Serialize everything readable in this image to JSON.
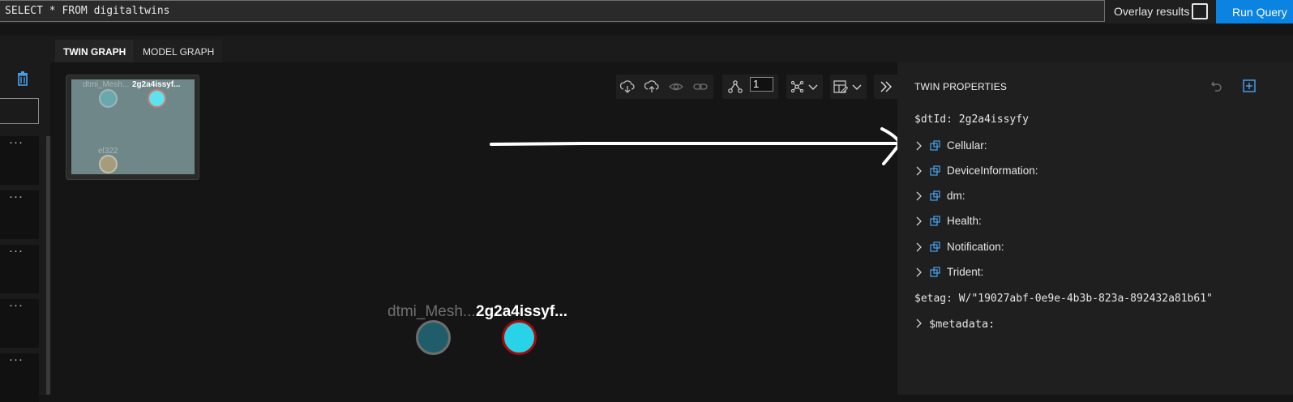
{
  "query": {
    "text": "SELECT * FROM digitaltwins"
  },
  "overlay": {
    "label": "Overlay results",
    "checked": false
  },
  "run_button": {
    "label": "Run Query"
  },
  "tabs": [
    {
      "label": "TWIN GRAPH",
      "active": true
    },
    {
      "label": "MODEL GRAPH",
      "active": false
    }
  ],
  "toolbar": {
    "expand_hops": "1"
  },
  "minimap": {
    "labels": [
      "dtmi_Mesh...",
      "2g2a4issyf...",
      "el322"
    ]
  },
  "graph": {
    "nodes": [
      {
        "label": "dtmi_Mesh...",
        "color": "#1f5d6b"
      },
      {
        "label": "2g2a4issyf...",
        "color": "#28d3e7",
        "selected": true
      }
    ]
  },
  "properties": {
    "title": "TWIN PROPERTIES",
    "dtId_key": "$dtId:",
    "dtId_value": "2g2a4issyfy",
    "components": [
      "Cellular:",
      "DeviceInformation:",
      "dm:",
      "Health:",
      "Notification:",
      "Trident:"
    ],
    "etag_key": "$etag:",
    "etag_value": "W/\"19027abf-0e9e-4b3b-823a-892432a81b61\"",
    "metadata_key": "$metadata:"
  },
  "colors": {
    "accent": "#0a84e0",
    "selected_border": "#a60a0a"
  }
}
